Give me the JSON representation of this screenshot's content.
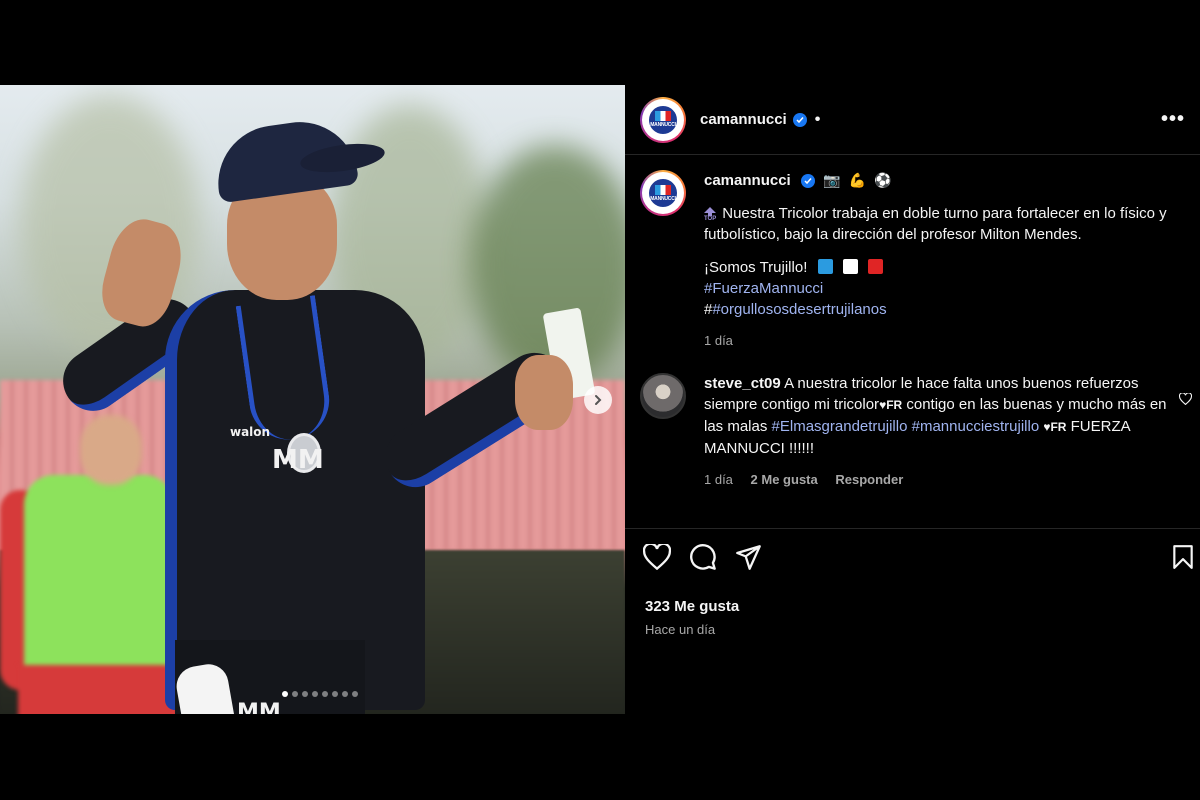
{
  "post": {
    "author": {
      "username": "camannucci",
      "crest_text": "MANNUCCI"
    },
    "header_dot": "•",
    "more_label": "•••",
    "caption": {
      "emojis": [
        "📷",
        "💪",
        "⚽"
      ],
      "top_badge": "TOP",
      "paragraph1": "Nuestra Tricolor trabaja en doble turno para fortalecer en lo físico y futbolístico, bajo la dirección del profesor Milton Mendes.",
      "paragraph2": "¡Somos Trujillo!",
      "flag_colors": [
        "#2b9be0",
        "#ffffff",
        "#e02525"
      ],
      "hashtag1": "#FuerzaMannucci",
      "hashtag2_prefix": "#",
      "hashtag2": "#orgullososdesertrujilanos",
      "time": "1 día"
    },
    "comment": {
      "username": "steve_ct09",
      "text_part1": "A nuestra tricolor le hace falta unos buenos refuerzos siempre contigo mi tricolor",
      "heart_suffix": "♥FR",
      "text_part2": " contigo en las buenas y mucho más en las malas ",
      "hashtag1": "#Elmasgrandetrujillo",
      "hashtag2": "#mannucciestrujillo",
      "text_part3": "FUERZA MANNUCCI !!!!!!",
      "time": "1 día",
      "likes": "2 Me gusta",
      "reply": "Responder"
    },
    "likes_count": "323 Me gusta",
    "posted": "Hace un día",
    "carousel": {
      "total": 8,
      "active_index": 0
    },
    "photo_text": {
      "brand": "walon",
      "initials": "MM"
    },
    "colors": {
      "link": "#a0b4f0",
      "verified": "#1877f2"
    }
  }
}
